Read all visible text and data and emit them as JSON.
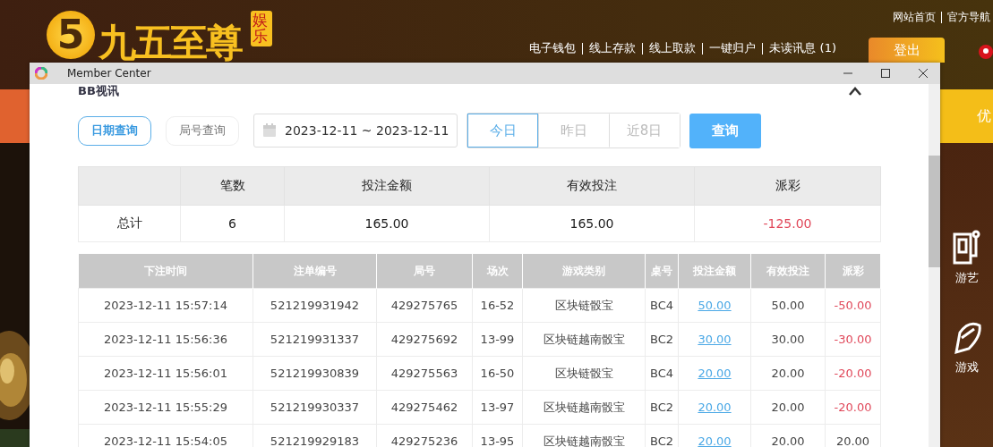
{
  "site": {
    "logo_mark": "5",
    "logo_text": "九五至尊",
    "logo_badge": "娱乐",
    "top_links": [
      "网站首页",
      "官方导航"
    ],
    "nav_links": [
      "电子钱包",
      "线上存款",
      "线上取款",
      "一键归户",
      "未读讯息 (1)"
    ],
    "logout": "登出",
    "promo_tab": "优",
    "side_items": [
      {
        "label": "游艺"
      },
      {
        "label": "游戏"
      }
    ]
  },
  "window": {
    "title": "Member Center"
  },
  "panel": {
    "heading": "BB视讯",
    "search_modes": [
      {
        "label": "日期查询",
        "selected": true
      },
      {
        "label": "局号查询",
        "selected": false
      }
    ],
    "date_range": "2023-12-11 ~ 2023-12-11",
    "quick_ranges": [
      {
        "label": "今日",
        "selected": true
      },
      {
        "label": "昨日",
        "selected": false
      },
      {
        "label": "近8日",
        "selected": false
      }
    ],
    "query_button": "查询"
  },
  "summary": {
    "columns": [
      "笔数",
      "投注金额",
      "有效投注",
      "派彩"
    ],
    "row_label": "总计",
    "values": [
      "6",
      "165.00",
      "165.00"
    ],
    "payout": "-125.00",
    "loss": true
  },
  "table": {
    "columns": [
      "下注时间",
      "注单编号",
      "局号",
      "场次",
      "游戏类别",
      "桌号",
      "投注金额",
      "有效投注",
      "派彩"
    ],
    "rows": [
      {
        "time": "2023-12-11 15:57:14",
        "order_no": "521219931942",
        "round_no": "429275765",
        "session": "16-52",
        "game": "区块链骰宝",
        "table": "BC4",
        "bet": "50.00",
        "valid": "50.00",
        "payout": "-50.00",
        "loss": true
      },
      {
        "time": "2023-12-11 15:56:36",
        "order_no": "521219931337",
        "round_no": "429275692",
        "session": "13-99",
        "game": "区块链越南骰宝",
        "table": "BC2",
        "bet": "30.00",
        "valid": "30.00",
        "payout": "-30.00",
        "loss": true
      },
      {
        "time": "2023-12-11 15:56:01",
        "order_no": "521219930839",
        "round_no": "429275563",
        "session": "16-50",
        "game": "区块链骰宝",
        "table": "BC4",
        "bet": "20.00",
        "valid": "20.00",
        "payout": "-20.00",
        "loss": true
      },
      {
        "time": "2023-12-11 15:55:29",
        "order_no": "521219930337",
        "round_no": "429275462",
        "session": "13-97",
        "game": "区块链越南骰宝",
        "table": "BC2",
        "bet": "20.00",
        "valid": "20.00",
        "payout": "-20.00",
        "loss": true
      },
      {
        "time": "2023-12-11 15:54:05",
        "order_no": "521219929183",
        "round_no": "429275236",
        "session": "13-95",
        "game": "区块链越南骰宝",
        "table": "BC2",
        "bet": "20.00",
        "valid": "20.00",
        "payout": "20.00",
        "loss": false
      }
    ]
  }
}
